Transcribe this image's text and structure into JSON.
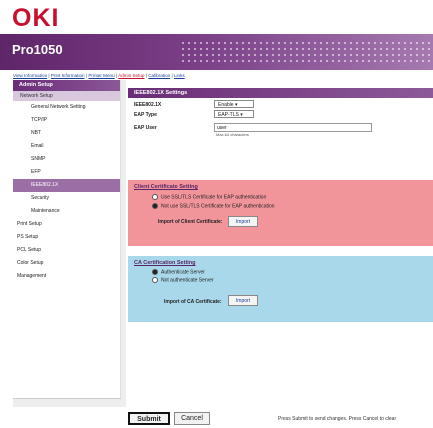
{
  "header": {
    "logo_text": "OKI",
    "product": "Pro1050"
  },
  "nav_links": [
    "View Information",
    "Print Information",
    "Printer Menu",
    "Admin Setup",
    "Calibration",
    "Links"
  ],
  "sidebar": {
    "heading": "Admin Setup",
    "selected": "Network Setup",
    "items": [
      {
        "label": "General Network Setting"
      },
      {
        "label": "TCP/IP"
      },
      {
        "label": "NBT"
      },
      {
        "label": "Email"
      },
      {
        "label": "SNMP"
      },
      {
        "label": "EFP"
      },
      {
        "label": "IEEE802.1X"
      },
      {
        "label": "Security"
      },
      {
        "label": "Maintenance"
      },
      {
        "label": "Print Setup"
      },
      {
        "label": "PS Setup"
      },
      {
        "label": "PCL Setup"
      },
      {
        "label": "Color Setup"
      },
      {
        "label": "Management"
      }
    ],
    "active_item": "IEEE802.1X"
  },
  "section": {
    "title": "IEEE802.1X Settings",
    "fields": {
      "ieee_label": "IEEE802.1X",
      "ieee_value": "Enable",
      "eap_type_label": "EAP Type",
      "eap_type_value": "EAP-TLS",
      "eap_user_label": "EAP User",
      "eap_user_value": "user",
      "eap_user_hint": "Max.64 characters"
    }
  },
  "client_cert": {
    "title": "Client Certificate Setting",
    "option1": "Use SSL/TLS Certificate for EAP authentication",
    "option2": "Not use SSL/TLS Certificate for EAP authentication",
    "import_label": "Import of Client Certificate:",
    "import_button": "Import",
    "color": "#f2959b"
  },
  "ca_cert": {
    "title": "CA Certification Setting",
    "option1": "Authenticate Server",
    "option2": "Not authenticate Server",
    "import_label": "Import of CA Certificate:",
    "import_button": "Import",
    "color": "#a8d8ea"
  },
  "footer": {
    "submit": "Submit",
    "cancel": "Cancel",
    "hint": "Press Submit to send changes. Press Cancel to clear"
  }
}
